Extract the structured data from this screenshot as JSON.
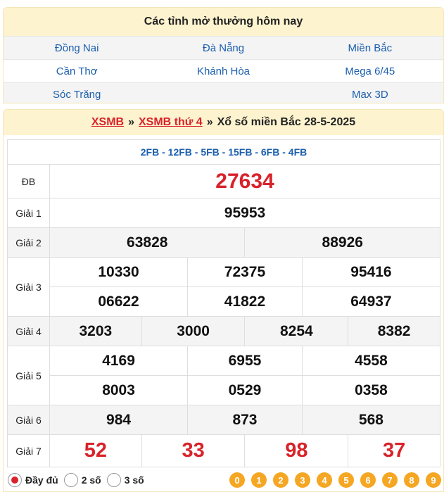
{
  "provinces": {
    "title": "Các tỉnh mở thưởng hôm nay",
    "rows": [
      [
        "Đồng Nai",
        "Đà Nẵng",
        "Miền Bắc"
      ],
      [
        "Cần Thơ",
        "Khánh Hòa",
        "Mega 6/45"
      ],
      [
        "Sóc Trăng",
        "",
        "Max 3D"
      ]
    ]
  },
  "breadcrumb": {
    "link1": "XSMB",
    "sep": "»",
    "link2": "XSMB thứ 4",
    "text": "Xổ số miền Bắc 28-5-2025"
  },
  "results": {
    "codes": "2FB - 12FB - 5FB - 15FB - 6FB - 4FB",
    "db_label": "ĐB",
    "db": "27634",
    "g1_label": "Giải 1",
    "g1": "95953",
    "g2_label": "Giải 2",
    "g2": [
      "63828",
      "88926"
    ],
    "g3_label": "Giải 3",
    "g3": [
      "10330",
      "72375",
      "95416",
      "06622",
      "41822",
      "64937"
    ],
    "g4_label": "Giải 4",
    "g4": [
      "3203",
      "3000",
      "8254",
      "8382"
    ],
    "g5_label": "Giải 5",
    "g5": [
      "4169",
      "6955",
      "4558",
      "8003",
      "0529",
      "0358"
    ],
    "g6_label": "Giải 6",
    "g6": [
      "984",
      "873",
      "568"
    ],
    "g7_label": "Giải 7",
    "g7": [
      "52",
      "33",
      "98",
      "37"
    ]
  },
  "footer": {
    "options": [
      "Đầy đủ",
      "2 số",
      "3 số"
    ],
    "selected": "Đầy đủ",
    "digits": [
      "0",
      "1",
      "2",
      "3",
      "4",
      "5",
      "6",
      "7",
      "8",
      "9"
    ]
  },
  "colors": {
    "header_bg": "#fdf3cf",
    "link_blue": "#1b5fae",
    "accent_red": "#d8232a",
    "digit_orange": "#f5a623"
  }
}
